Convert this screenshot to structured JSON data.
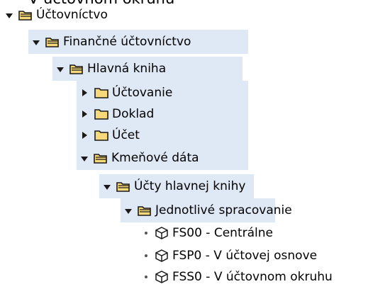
{
  "cut_text": "V účtovnom okruhu",
  "tree": {
    "root": "Účtovníctvo",
    "financial": "Finančné účtovníctvo",
    "general_ledger": "Hlavná kniha",
    "posting": "Účtovanie",
    "document": "Doklad",
    "account": "Účet",
    "master_data": "Kmeňové dáta",
    "gl_accounts": "Účty hlavnej knihy",
    "individual_processing": "Jednotlivé spracovanie",
    "tx_fs00": "FS00 - Centrálne",
    "tx_fsp0": "FSP0 - V účtovej osnove",
    "tx_fss0": "FSS0 - V účtovnom okruhu"
  },
  "colors": {
    "row_highlight": "#dfe8f5",
    "folder_fill": "#f7d87a",
    "folder_stroke": "#1a1a1a"
  },
  "icons": {
    "open_folder": "folder-open-icon",
    "closed_folder": "folder-closed-icon",
    "transaction": "cube-icon",
    "expanded": "triangle-down-icon",
    "collapsed": "triangle-right-icon"
  }
}
